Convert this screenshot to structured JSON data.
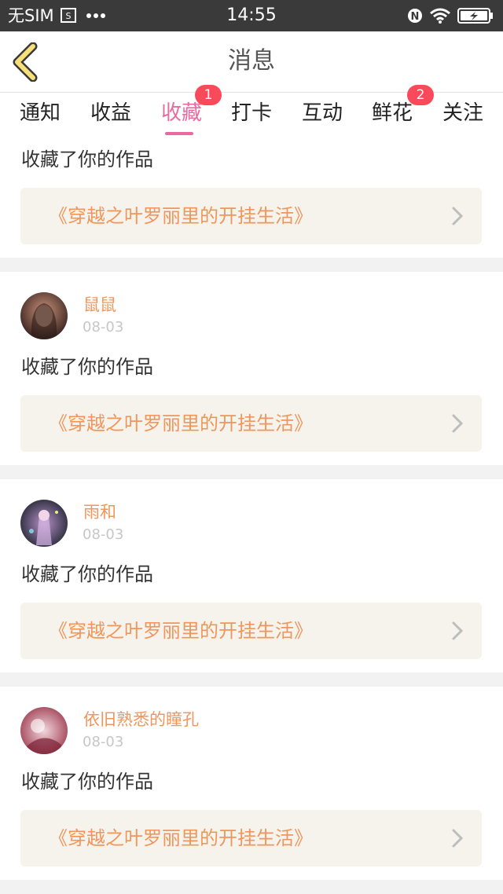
{
  "status_bar": {
    "carrier": "无SIM",
    "time": "14:55",
    "icons": [
      "sim-card-icon",
      "more-dots-icon",
      "nfc-icon",
      "wifi-icon",
      "battery-charging-icon"
    ]
  },
  "header": {
    "title": "消息",
    "back_icon": "chevron-left-icon"
  },
  "tabs": [
    {
      "label": "通知",
      "badge": ""
    },
    {
      "label": "收益",
      "badge": ""
    },
    {
      "label": "收藏",
      "badge": "1",
      "active": true
    },
    {
      "label": "打卡",
      "badge": ""
    },
    {
      "label": "互动",
      "badge": ""
    },
    {
      "label": "鲜花",
      "badge": "2"
    },
    {
      "label": "关注",
      "badge": ""
    }
  ],
  "messages": [
    {
      "username": "",
      "date": "",
      "action": "收藏了你的作品",
      "work": "《穿越之叶罗丽里的开挂生活》"
    },
    {
      "username": "鼠鼠",
      "date": "08-03",
      "action": "收藏了你的作品",
      "work": "《穿越之叶罗丽里的开挂生活》"
    },
    {
      "username": "雨和",
      "date": "08-03",
      "action": "收藏了你的作品",
      "work": "《穿越之叶罗丽里的开挂生活》"
    },
    {
      "username": "依旧熟悉的瞳孔",
      "date": "08-03",
      "action": "收藏了你的作品",
      "work": "《穿越之叶罗丽里的开挂生活》"
    }
  ],
  "colors": {
    "accent": "#e96aa0",
    "username": "#f0965c",
    "badge": "#f84a5b",
    "work_box": "#f5f3ec"
  }
}
